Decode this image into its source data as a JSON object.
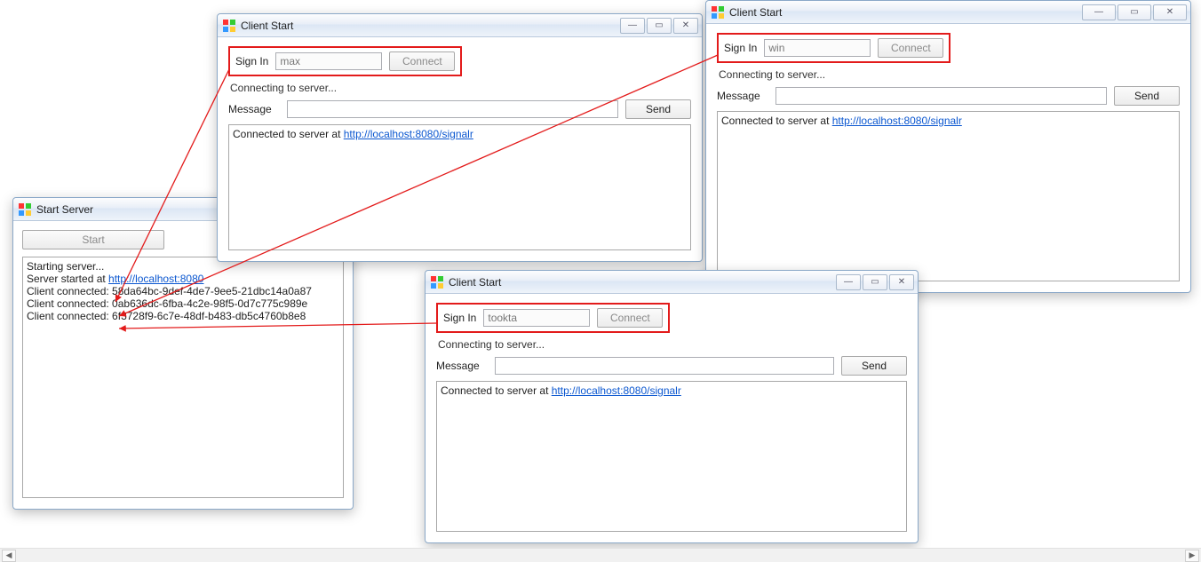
{
  "server_window": {
    "title": "Start Server",
    "start_button": "Start",
    "log_lines": {
      "l0": "Starting server...",
      "l1_prefix": "Server started at ",
      "l1_link": "http://localhost:8080",
      "l2": "Client connected: 58da64bc-9def-4de7-9ee5-21dbc14a0a87",
      "l3": "Client connected: 0ab636dc-6fba-4c2e-98f5-0d7c775c989e",
      "l4": "Client connected: 6f3728f9-6c7e-48df-b483-db5c4760b8e8"
    }
  },
  "client_top_left": {
    "title": "Client Start",
    "signin_label": "Sign In",
    "signin_value": "max",
    "connect_label": "Connect",
    "status": "Connecting to server...",
    "message_label": "Message",
    "message_value": "",
    "send_label": "Send",
    "log_prefix": "Connected to server at ",
    "log_link": "http://localhost:8080/signalr"
  },
  "client_top_right": {
    "title": "Client Start",
    "signin_label": "Sign In",
    "signin_value": "win",
    "connect_label": "Connect",
    "status": "Connecting to server...",
    "message_label": "Message",
    "message_value": "",
    "send_label": "Send",
    "log_prefix": "Connected to server at ",
    "log_link": "http://localhost:8080/signalr"
  },
  "client_bottom": {
    "title": "Client Start",
    "signin_label": "Sign In",
    "signin_value": "tookta",
    "connect_label": "Connect",
    "status": "Connecting to server...",
    "message_label": "Message",
    "message_value": "",
    "send_label": "Send",
    "log_prefix": "Connected to server at ",
    "log_link": "http://localhost:8080/signalr"
  }
}
